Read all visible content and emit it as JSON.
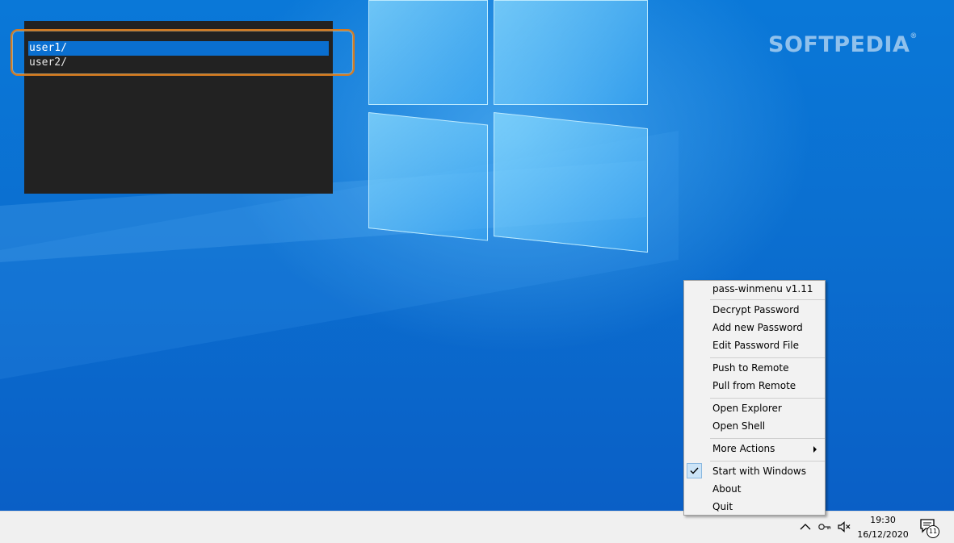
{
  "watermark": {
    "text": "SOFTPEDIA",
    "mark": "®"
  },
  "dmenu": {
    "items": [
      {
        "label": "user1/",
        "selected": true
      },
      {
        "label": "user2/",
        "selected": false
      }
    ]
  },
  "context_menu": {
    "title": "pass-winmenu v1.11",
    "decrypt": "Decrypt Password",
    "add": "Add new Password",
    "edit": "Edit Password File",
    "push": "Push to Remote",
    "pull": "Pull from Remote",
    "explorer": "Open Explorer",
    "shell": "Open Shell",
    "more": "More Actions",
    "startup": "Start with Windows",
    "startup_checked": true,
    "about": "About",
    "quit": "Quit"
  },
  "taskbar": {
    "time": "19:30",
    "date": "16/12/2020",
    "notification_count": "11",
    "icons": [
      "chevron-up-icon",
      "key-icon",
      "speaker-muted-icon",
      "notification-icon"
    ]
  },
  "colors": {
    "accent": "#0a6fd0",
    "highlight": "#d67a1e",
    "dmenu_bg": "#222222"
  }
}
